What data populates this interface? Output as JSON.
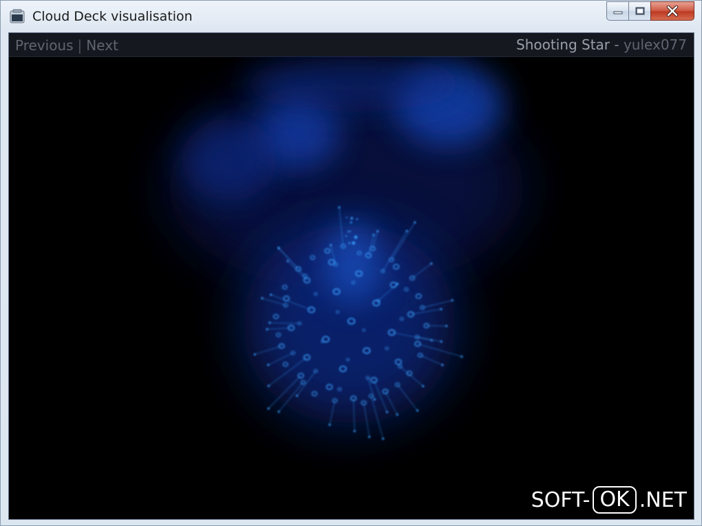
{
  "window": {
    "title": "Cloud Deck visualisation"
  },
  "nav": {
    "previous": "Previous",
    "separator": "|",
    "next": "Next",
    "track": "Shooting Star",
    "dash": "-",
    "author": "yulex077"
  },
  "watermark": {
    "prefix": "SOFT-",
    "boxed": "OK",
    "suffix": ".NET"
  },
  "colors": {
    "glow": "#1a5fd0",
    "particle": "#3aa0ff"
  },
  "icons": {
    "app": "app-window-icon",
    "minimize": "minimize-icon",
    "maximize": "maximize-icon",
    "close": "close-icon"
  }
}
